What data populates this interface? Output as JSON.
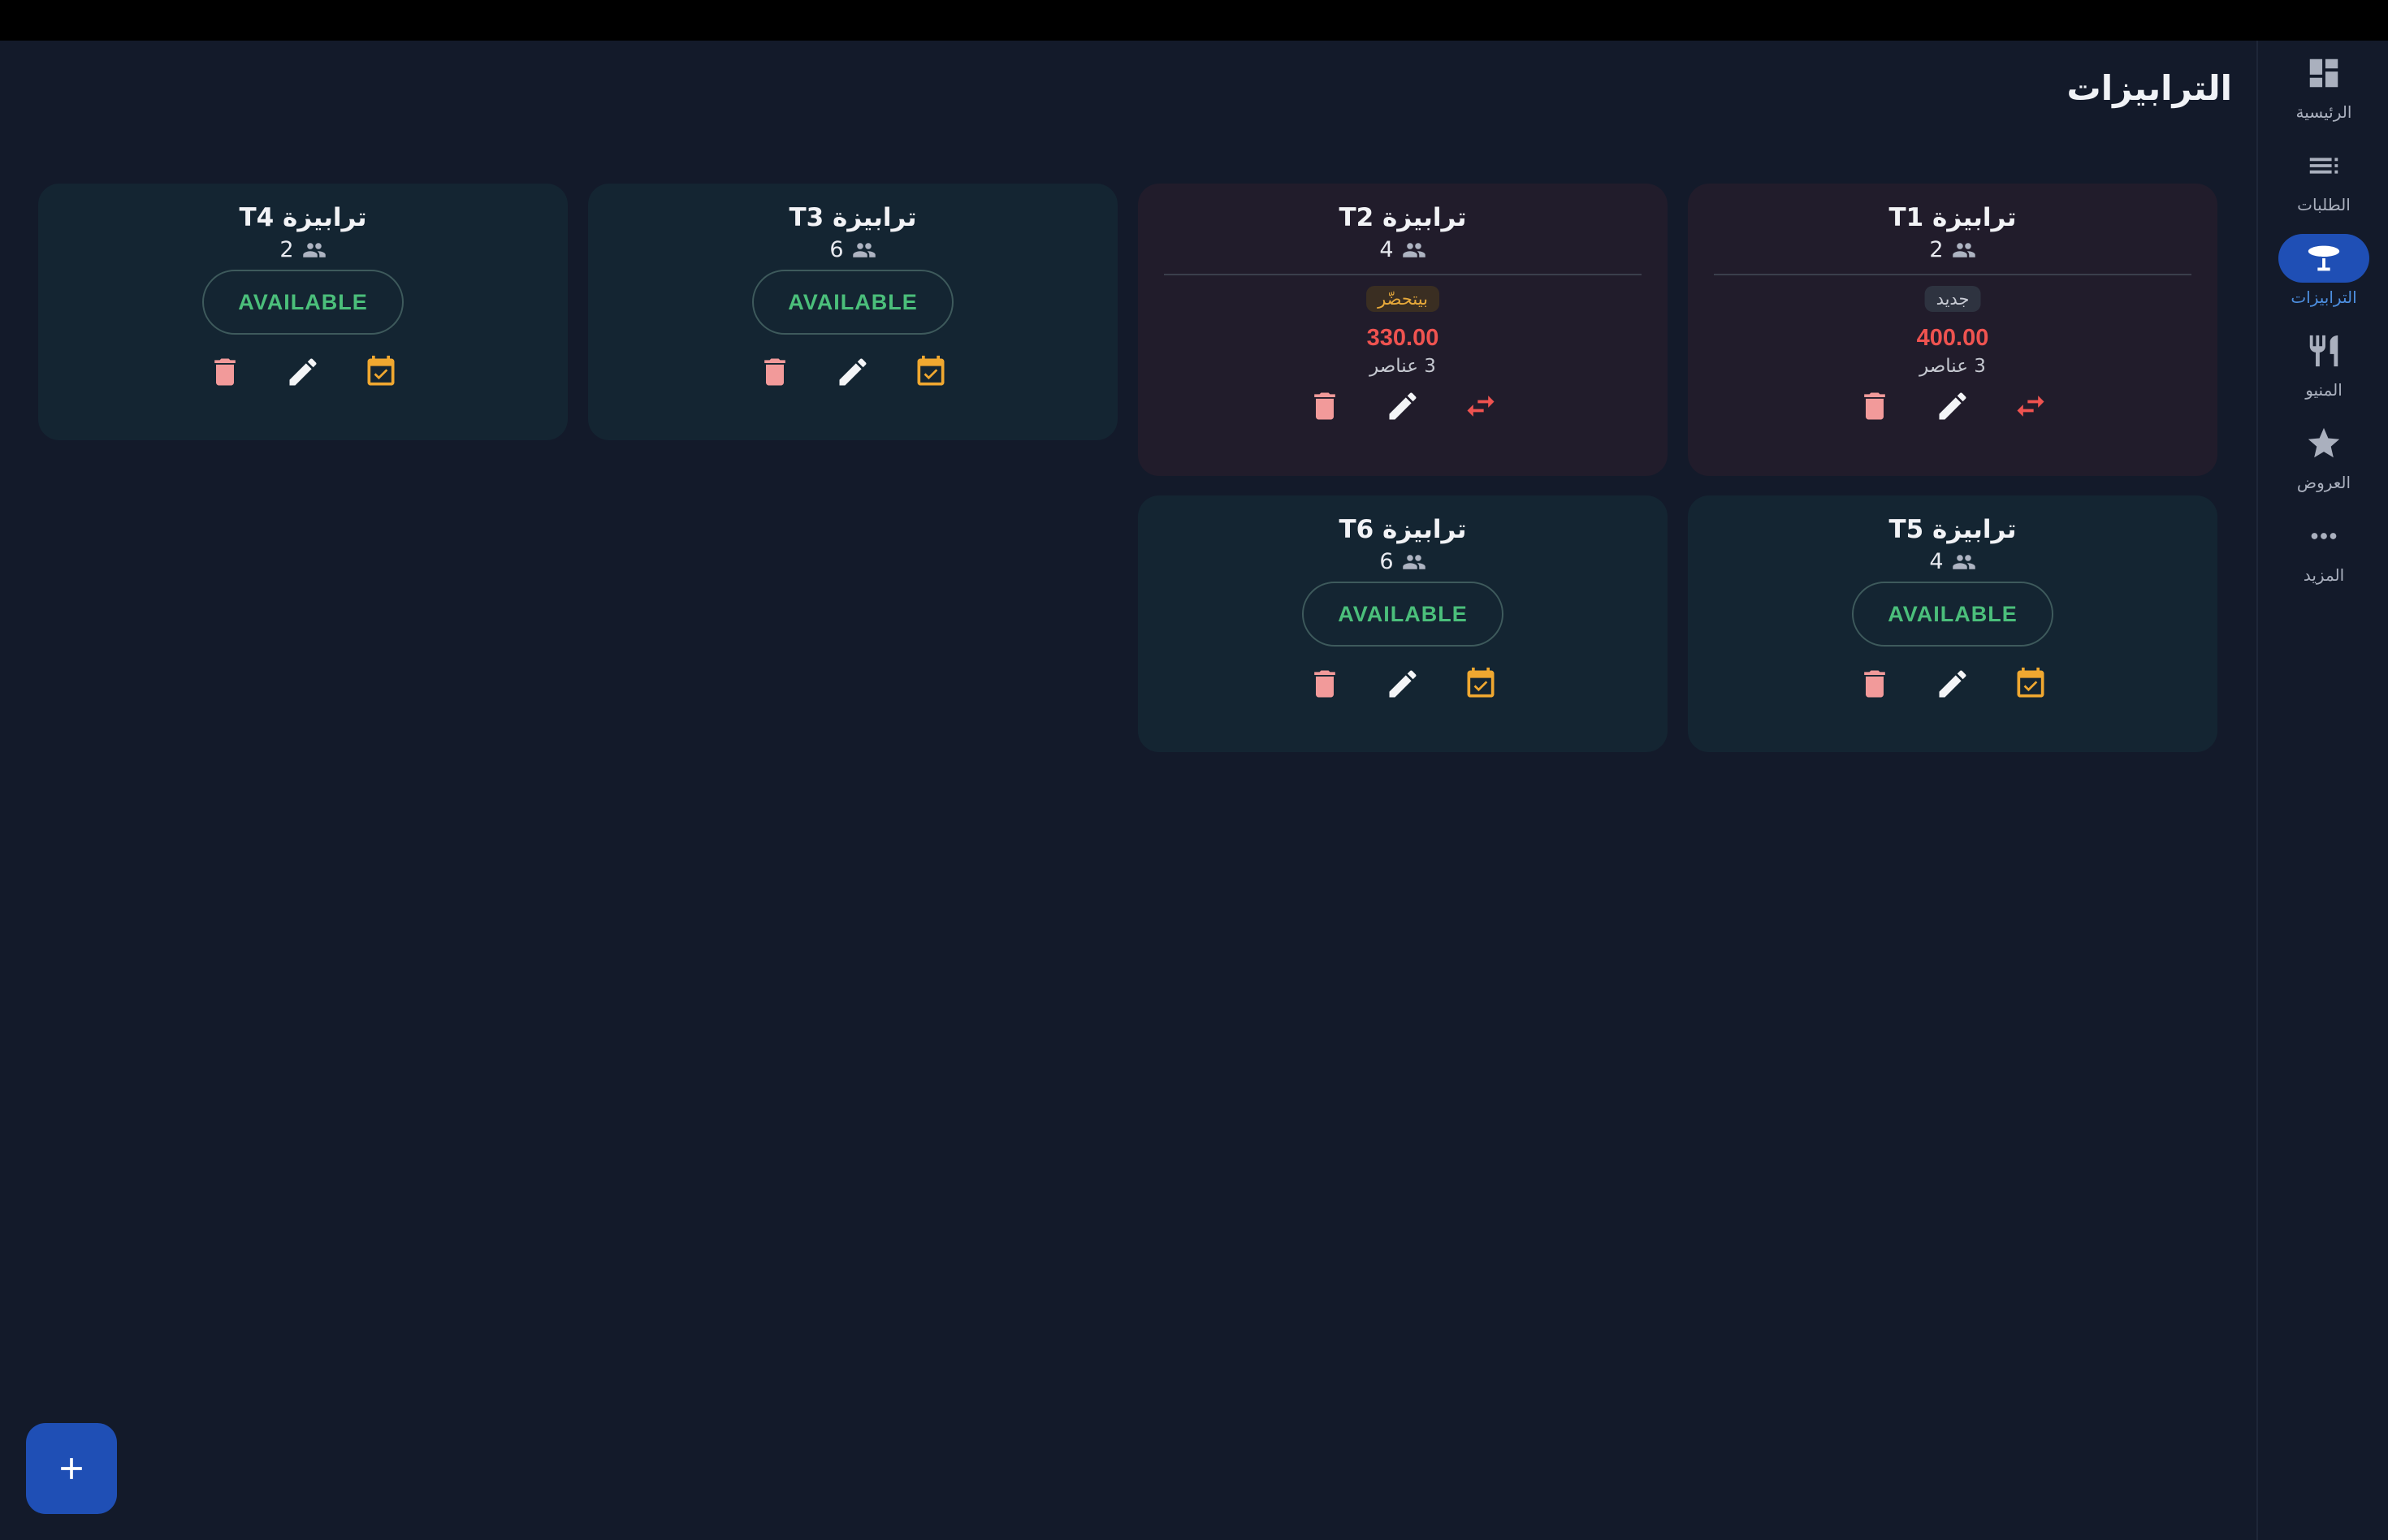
{
  "page": {
    "title": "الترابيزات"
  },
  "nav": [
    {
      "id": "home",
      "label": "الرئيسية",
      "icon": "dashboard-icon",
      "active": false
    },
    {
      "id": "orders",
      "label": "الطلبات",
      "icon": "list-icon",
      "active": false
    },
    {
      "id": "tables",
      "label": "الترابيزات",
      "icon": "table-icon",
      "active": true
    },
    {
      "id": "menu",
      "label": "المنيو",
      "icon": "restaurant-icon",
      "active": false
    },
    {
      "id": "offers",
      "label": "العروض",
      "icon": "star-icon",
      "active": false
    },
    {
      "id": "more",
      "label": "المزيد",
      "icon": "more-icon",
      "active": false
    }
  ],
  "tables": [
    {
      "name": "ترابيزة T1",
      "seats": "2",
      "occupied": true,
      "status": "جديد",
      "status_kind": "new",
      "total": "400.00",
      "items": "3 عناصر"
    },
    {
      "name": "ترابيزة T2",
      "seats": "4",
      "occupied": true,
      "status": "بيتحضّر",
      "status_kind": "prep",
      "total": "330.00",
      "items": "3 عناصر"
    },
    {
      "name": "ترابيزة T3",
      "seats": "6",
      "occupied": false,
      "status": "AVAILABLE"
    },
    {
      "name": "ترابيزة T4",
      "seats": "2",
      "occupied": false,
      "status": "AVAILABLE"
    },
    {
      "name": "ترابيزة T5",
      "seats": "4",
      "occupied": false,
      "status": "AVAILABLE"
    },
    {
      "name": "ترابيزة T6",
      "seats": "6",
      "occupied": false,
      "status": "AVAILABLE"
    }
  ],
  "fab": {
    "icon": "plus-icon"
  },
  "colors": {
    "background": "#131a2a",
    "card_free": "#142532",
    "card_busy": "#211c2b",
    "accent": "#1f4fb5",
    "available_green": "#4bbf7b",
    "total_red": "#ef5350",
    "delete_pink": "#f29a9a",
    "reserve_orange": "#f0a830"
  }
}
